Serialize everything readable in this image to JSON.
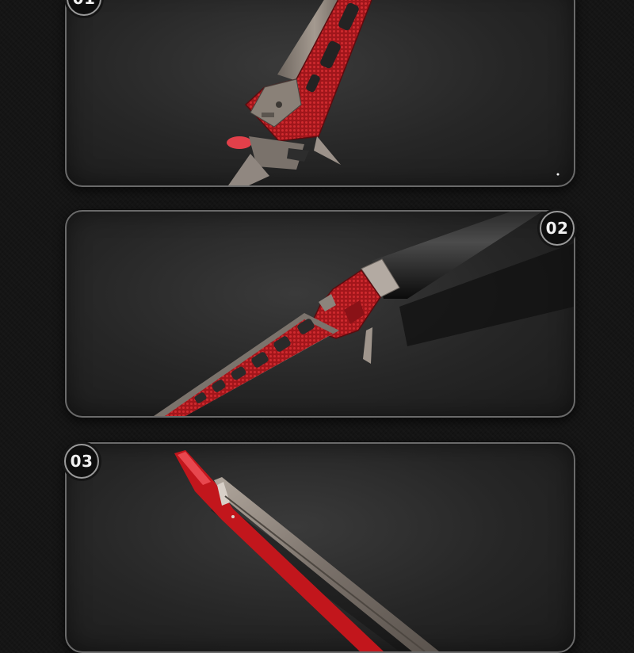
{
  "sections": [
    {
      "number": "01"
    },
    {
      "number": "02"
    },
    {
      "number": "03"
    }
  ],
  "colors": {
    "background": "#151515",
    "panel": "#2a2a2a",
    "accent_red": "#b3151b",
    "metal": "#8a8178"
  }
}
